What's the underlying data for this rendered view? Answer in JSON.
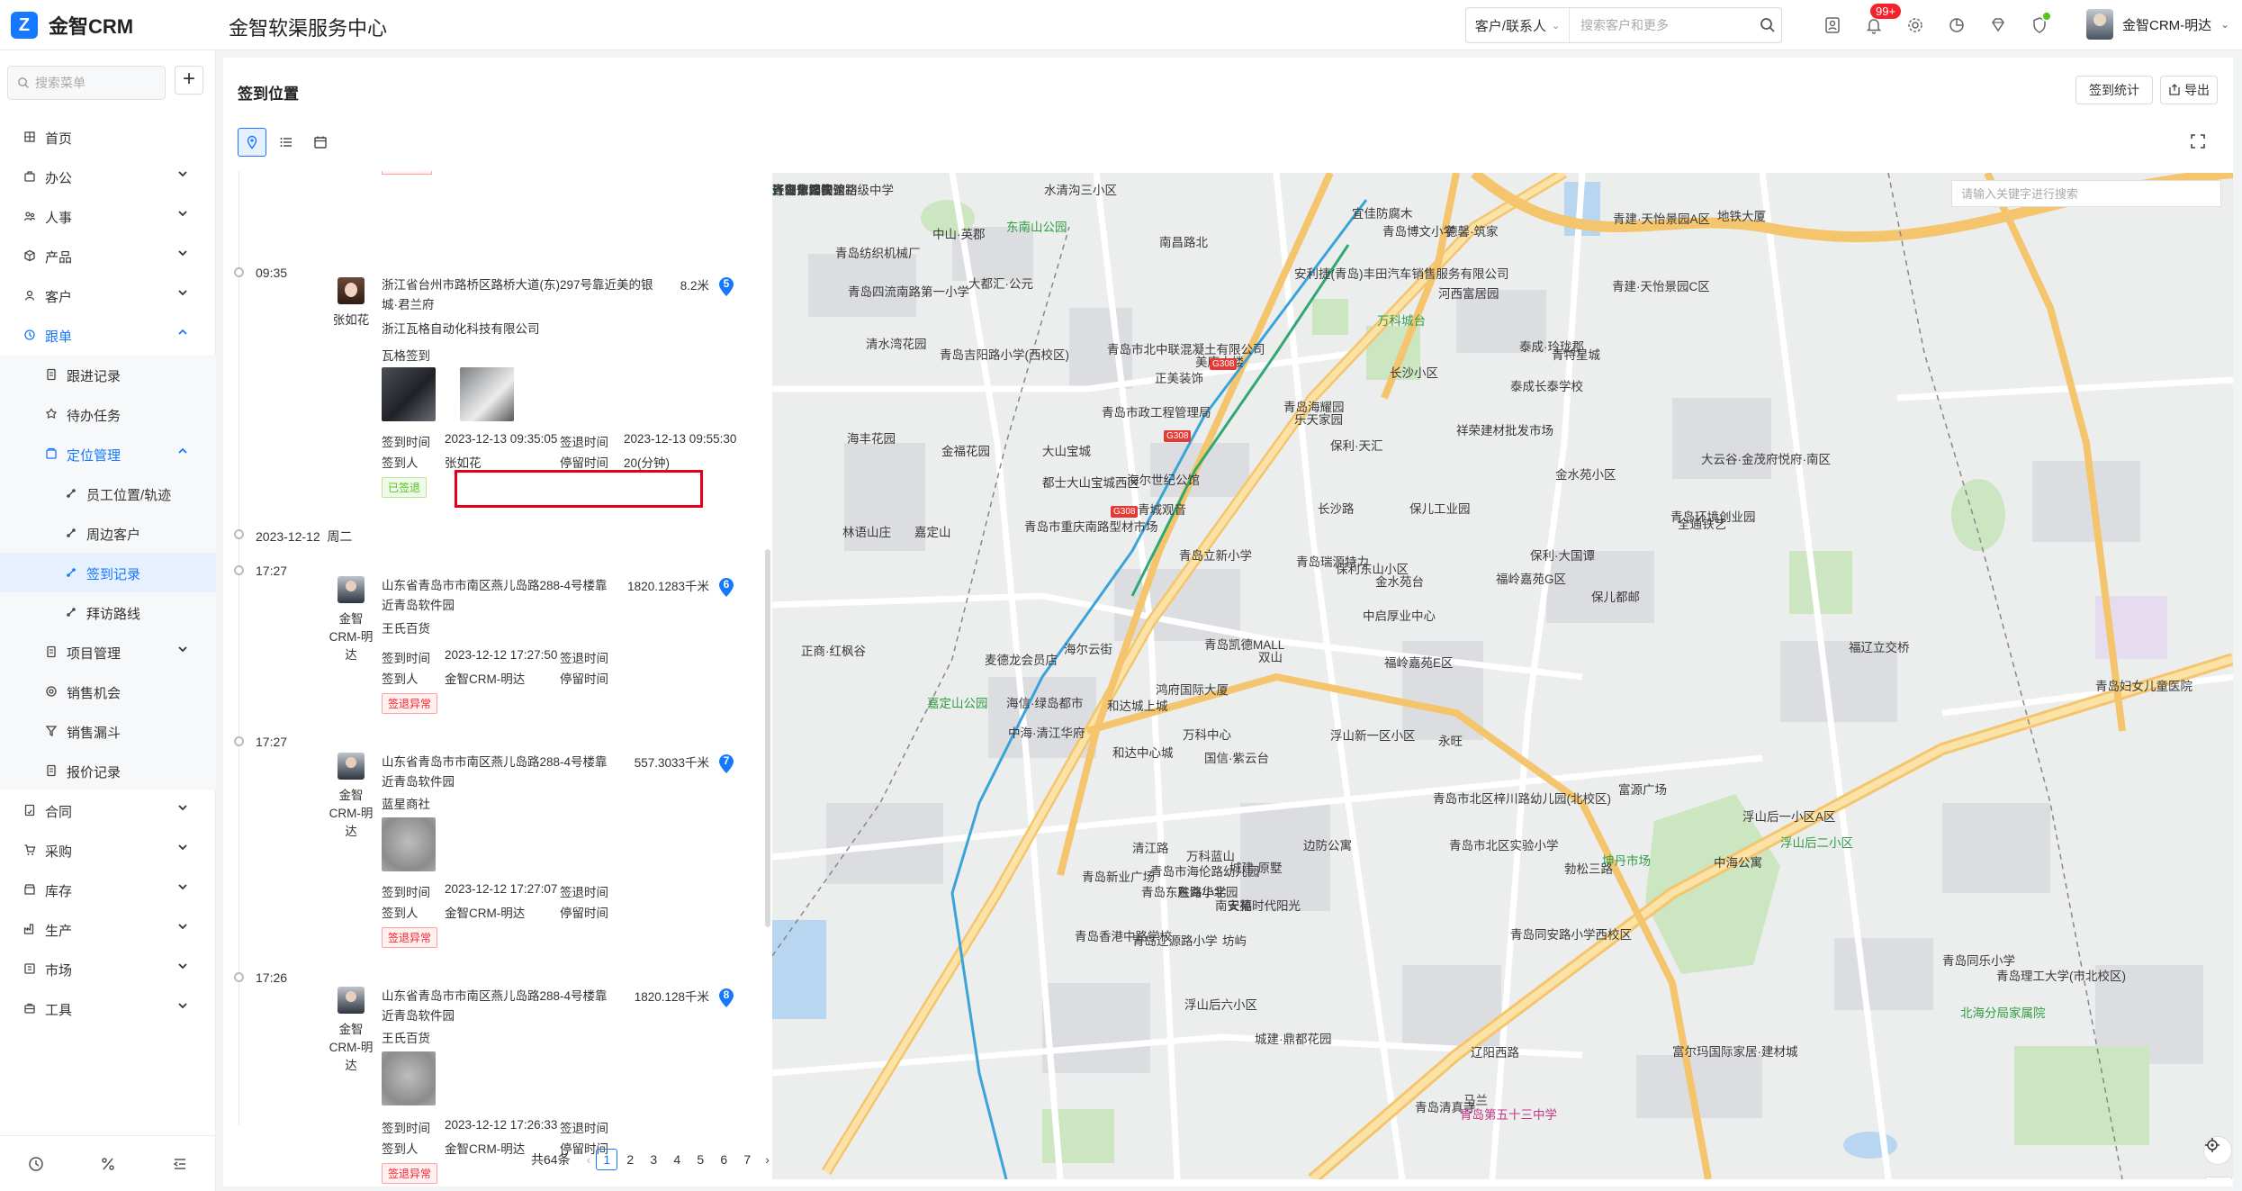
{
  "header": {
    "brand": "金智CRM",
    "center_title": "金智软渠服务中心",
    "search_type": "客户/联系人",
    "search_placeholder": "搜索客户和更多",
    "notification_count": "99+",
    "user_name": "金智CRM-明达"
  },
  "sidebar": {
    "search_placeholder": "搜索菜单",
    "items": [
      {
        "label": "首页"
      },
      {
        "label": "办公"
      },
      {
        "label": "人事"
      },
      {
        "label": "产品"
      },
      {
        "label": "客户"
      },
      {
        "label": "跟单"
      },
      {
        "label": "跟进记录"
      },
      {
        "label": "待办任务"
      },
      {
        "label": "定位管理"
      },
      {
        "label": "员工位置/轨迹"
      },
      {
        "label": "周边客户"
      },
      {
        "label": "签到记录"
      },
      {
        "label": "拜访路线"
      },
      {
        "label": "项目管理"
      },
      {
        "label": "销售机会"
      },
      {
        "label": "销售漏斗"
      },
      {
        "label": "报价记录"
      },
      {
        "label": "合同"
      },
      {
        "label": "采购"
      },
      {
        "label": "库存"
      },
      {
        "label": "生产"
      },
      {
        "label": "市场"
      },
      {
        "label": "工具"
      }
    ]
  },
  "page": {
    "title": "签到位置",
    "btn_stats": "签到统计",
    "btn_export": "导出"
  },
  "records": [
    {
      "time": "09:35",
      "author": "张如花",
      "address": "浙江省台州市路桥区路桥大道(东)297号靠近美的银城·君兰府",
      "distance": "8.2米",
      "index": "5",
      "company": "浙江瓦格自动化科技有限公司",
      "note": "瓦格签到",
      "k_checkin_time": "签到时间",
      "v_checkin_time": "2023-12-13 09:35:05",
      "k_checkout_time": "签退时间",
      "v_checkout_time": "2023-12-13 09:55:30",
      "k_person": "签到人",
      "v_person": "张如花",
      "k_stay": "停留时间",
      "v_stay": "20(分钟)",
      "status": "已签退"
    },
    {
      "time": "17:27",
      "author": "金智CRM-明达",
      "address": "山东省青岛市市南区燕儿岛路288-4号楼靠近青岛软件园",
      "distance": "1820.1283千米",
      "index": "6",
      "company": "王氏百货",
      "k_checkin_time": "签到时间",
      "v_checkin_time": "2023-12-12 17:27:50",
      "k_checkout_time": "签退时间",
      "k_person": "签到人",
      "v_person": "金智CRM-明达",
      "k_stay": "停留时间",
      "status": "签退异常"
    },
    {
      "time": "17:27",
      "author": "金智CRM-明达",
      "address": "山东省青岛市市南区燕儿岛路288-4号楼靠近青岛软件园",
      "distance": "557.3033千米",
      "index": "7",
      "company": "蓝星商社",
      "k_checkin_time": "签到时间",
      "v_checkin_time": "2023-12-12 17:27:07",
      "k_checkout_time": "签退时间",
      "k_person": "签到人",
      "v_person": "金智CRM-明达",
      "k_stay": "停留时间",
      "status": "签退异常"
    },
    {
      "time": "17:26",
      "author": "金智CRM-明达",
      "address": "山东省青岛市市南区燕儿岛路288-4号楼靠近青岛软件园",
      "distance": "1820.128千米",
      "index": "8",
      "company": "王氏百货",
      "k_checkin_time": "签到时间",
      "v_checkin_time": "2023-12-12 17:26:33",
      "k_checkout_time": "签退时间",
      "k_person": "签到人",
      "v_person": "金智CRM-明达",
      "k_stay": "停留时间",
      "status": "签退异常"
    }
  ],
  "date_divider": {
    "date": "2023-12-12",
    "weekday": "周二"
  },
  "pagination": {
    "total": "共64条",
    "pages": [
      "1",
      "2",
      "3",
      "4",
      "5",
      "6",
      "7"
    ],
    "current": "1"
  },
  "map": {
    "search_placeholder": "请输入关键字进行搜索",
    "highway": "G308",
    "labels": [
      "水清沟三小区",
      "东南山公园",
      "中山·英郡",
      "青岛纺织机械厂",
      "大都汇·公元",
      "南昌路北",
      "宜佳防腐木",
      "安利捷(青岛)丰田汽车销售服务有限公司",
      "青岛博文小学",
      "德馨·筑家",
      "青建·天怡景园A区",
      "地铁大厦",
      "青建·天怡景园C区",
      "青岛四流南路第一小学",
      "青岛吉阳路小学(西校区)",
      "万科城台",
      "河西富居园",
      "泰成·玲珑郡",
      "青特星城",
      "长沙小区",
      "泰成长泰学校",
      "清水湾花园",
      "海丰花园",
      "金福花园",
      "青岛市北中联混凝土有限公司",
      "美康大楼",
      "正美装饰",
      "青岛市政工程管理局",
      "大山宝城",
      "青岛海耀园",
      "乐天家园",
      "祥荣建材批发市场",
      "金水苑小区",
      "大云谷·金茂府悦府·南区",
      "全通铁艺",
      "保利·天汇",
      "长沙路",
      "保儿工业园",
      "都士大山宝城西区",
      "海尔世纪公馆",
      "青城观音",
      "青岛瑞源特力",
      "保利东山小区",
      "福岭嘉苑G区",
      "保利·大国谭",
      "青岛市重庆南路型材市场",
      "青岛立新小学",
      "保儿都邮",
      "中启厚业中心",
      "金水苑台",
      "海尔云街",
      "青岛凯德MALL",
      "双山",
      "福岭嘉苑E区",
      "林语山庄",
      "嘉定山",
      "正商·红枫谷",
      "麦德龙会员店",
      "嘉定山公园",
      "海信·绿岛都市",
      "和达城上城",
      "鸿府国际大厦",
      "万科中心",
      "青岛市北区实验小学",
      "中海·清江华府",
      "和达中心城",
      "国信·紫云台",
      "浮山新一区小区",
      "永旺",
      "青岛环境创业园",
      "清江路",
      "万科蓝山",
      "城建·原墅",
      "青岛市北区梓川路幼儿园(北校区)",
      "富源广场",
      "浮山后一小区A区",
      "浮山后二小区",
      "青岛市海伦路幼儿园",
      "青岛东胜路小学",
      "东海华北园",
      "青岛香港中路学校",
      "青岛辽源路小学",
      "南安苑",
      "天福时代阳光",
      "坊屿",
      "勃松三路",
      "边防公寓",
      "青岛同安路小学西校区",
      "坤丹市场",
      "中海公寓",
      "浮山后六小区",
      "城建·鼎都花园",
      "辽阳西路",
      "青岛清真寺",
      "马兰",
      "青岛第五十三中学",
      "青岛新业广场",
      "富尔玛国际家居·建材城",
      "福辽立交桥",
      "青岛妇女儿童医院",
      "青岛理工大学(市北校区)",
      "北海分局家属院",
      "青岛同乐小学",
      "齐鲁休公园",
      "好一家园",
      "青岛第二实验初级中学",
      "环湖公园",
      "辽阳东路快速路",
      "青岛市博物馆"
    ]
  }
}
